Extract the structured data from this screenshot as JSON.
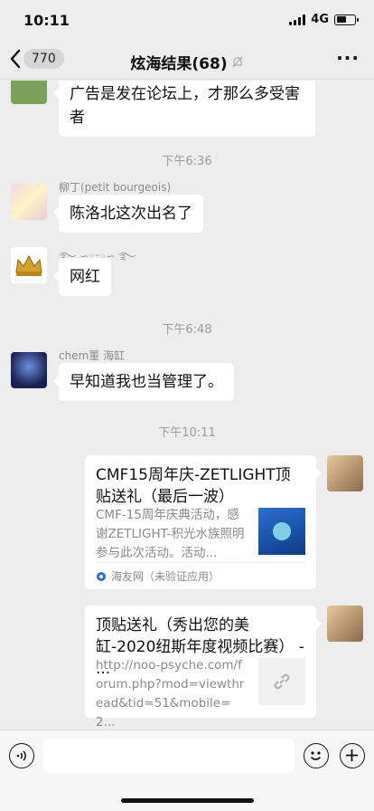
{
  "status_bar": {
    "time": "10:11",
    "network": "4G"
  },
  "nav": {
    "back_badge": "770",
    "title": "炫海结果(68)"
  },
  "messages": [
    {
      "type": "text",
      "sender": "",
      "text": "广告是发在论坛上，才那么多受害者"
    },
    {
      "type": "time",
      "text": "下午6:36"
    },
    {
      "type": "text",
      "sender": "柳丁(petit bourgeois)",
      "text": "陈洛北这次出名了"
    },
    {
      "type": "text",
      "sender": "",
      "text": "网红"
    },
    {
      "type": "time",
      "text": "下午6:48"
    },
    {
      "type": "text",
      "sender": "chem董 海缸",
      "text": "早知道我也当管理了。"
    },
    {
      "type": "time",
      "text": "下午10:11"
    },
    {
      "type": "link_card",
      "title": "CMF15周年庆-ZETLIGHT顶贴送礼（最后一波）",
      "description": "CMF-15周年庆典活动，感谢ZETLIGHT-积光水族照明参与此次活动。活动...",
      "source": "海友网（未验证应用）"
    },
    {
      "type": "link_card",
      "title": "顶贴送礼（秀出您的美缸-2020纽斯年度视频比赛） - ...",
      "description": "http://noo-psyche.com/forum.php?mod=viewthread&tid=51&mobile=2..."
    }
  ],
  "colors": {
    "background": "#ededed",
    "bubble": "#ffffff",
    "timestamp": "#9b9b9b"
  }
}
